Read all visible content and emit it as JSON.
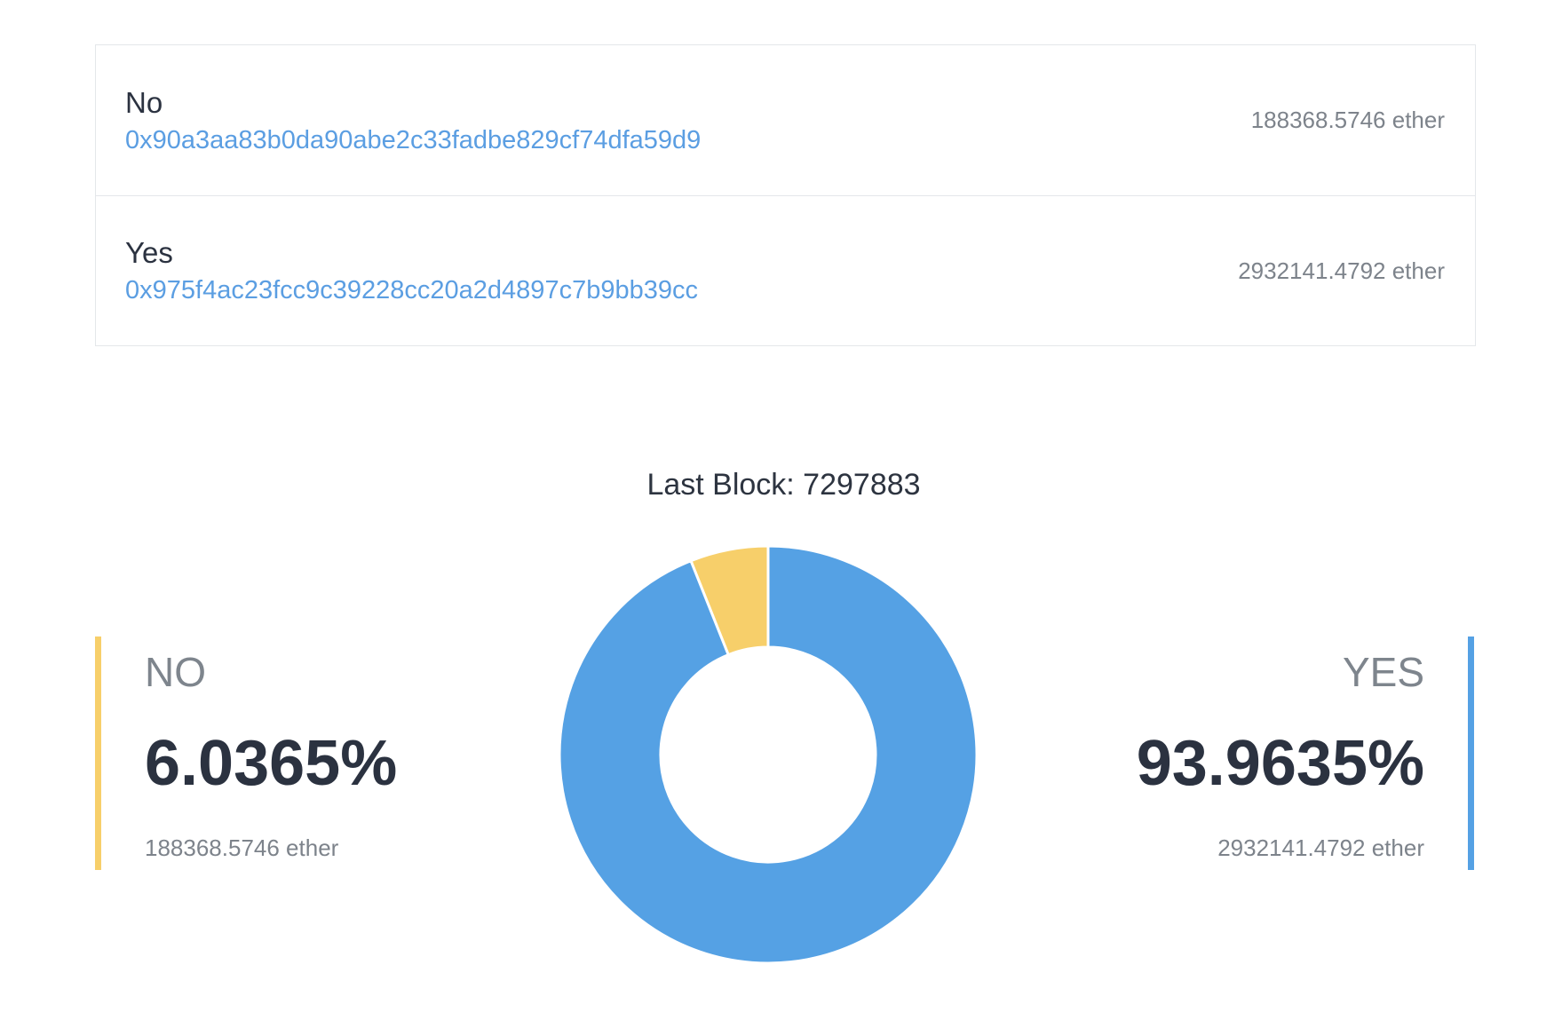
{
  "options": [
    {
      "name": "No",
      "address": "0x90a3aa83b0da90abe2c33fadbe829cf74dfa59d9",
      "amount": "188368.5746 ether"
    },
    {
      "name": "Yes",
      "address": "0x975f4ac23fcc9c39228cc20a2d4897c7b9bb39cc",
      "amount": "2932141.4792 ether"
    }
  ],
  "last_block": "Last Block: 7297883",
  "stats": {
    "no": {
      "label": "NO",
      "percent": "6.0365%",
      "ether": "188368.5746 ether"
    },
    "yes": {
      "label": "YES",
      "percent": "93.9635%",
      "ether": "2932141.4792 ether"
    }
  },
  "colors": {
    "no": "#f7cf6a",
    "yes": "#55a1e4",
    "link": "#5b9ee2"
  },
  "chart_data": {
    "type": "pie",
    "categories": [
      "NO",
      "YES"
    ],
    "values": [
      6.0365,
      93.9635
    ],
    "colors": [
      "#f7cf6a",
      "#55a1e4"
    ],
    "donut": true
  }
}
